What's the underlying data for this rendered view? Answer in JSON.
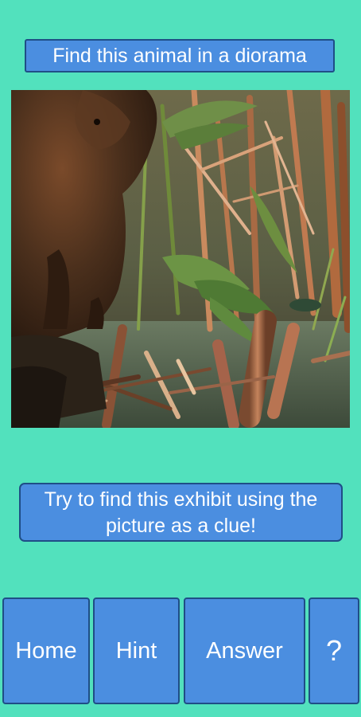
{
  "header": {
    "title": "Find this animal in a diorama"
  },
  "photo": {
    "description_icon": "diorama-photo",
    "colors": {
      "fur": "#4a2f1c",
      "leaf": "#5b7e3a",
      "reed": "#c0835a",
      "water": "#4c5d46",
      "wood": "#a76542"
    }
  },
  "clue": {
    "text": "Try to find this exhibit using the picture as a clue!"
  },
  "nav": {
    "home_label": "Home",
    "hint_label": "Hint",
    "answer_label": "Answer",
    "help_label": "?"
  },
  "colors": {
    "background": "#52e1bd",
    "button": "#4b8ee0",
    "button_border": "#1f4e86",
    "text": "#ffffff"
  }
}
